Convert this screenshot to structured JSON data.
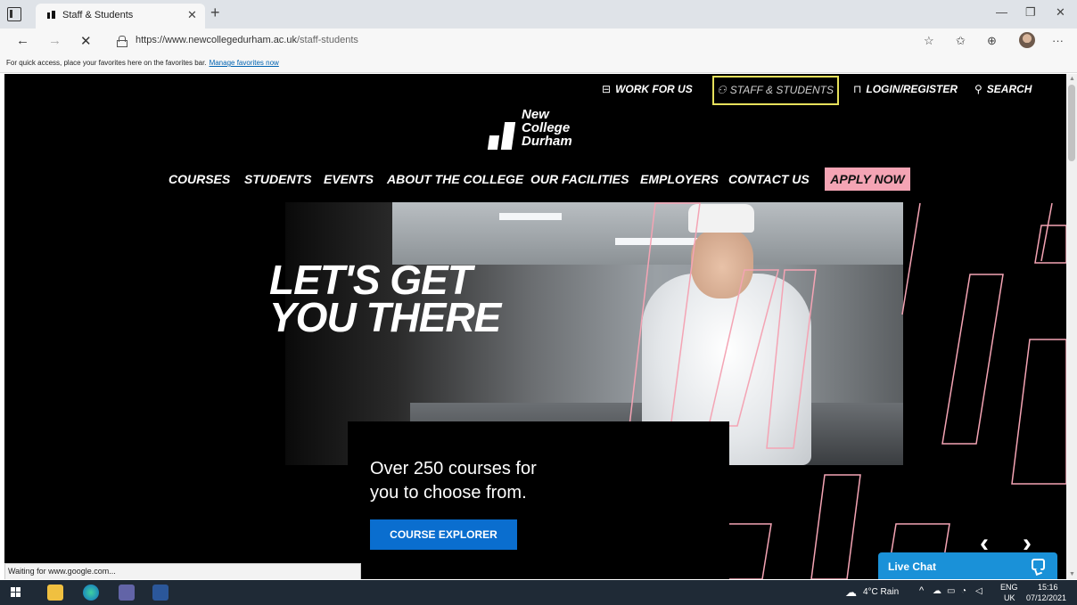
{
  "browser": {
    "tab_title": "Staff & Students",
    "url_host": "https://www.newcollegedurham.ac.uk",
    "url_path": "/staff-students",
    "favorites_prompt": "For quick access, place your favorites here on the favorites bar.",
    "favorites_link": "Manage favorites now",
    "status_text": "Waiting for www.google.com..."
  },
  "site": {
    "utility_nav": [
      {
        "label": "WORK FOR US",
        "icon": "briefcase-icon"
      },
      {
        "label": "STAFF & STUDENTS",
        "icon": "people-icon"
      },
      {
        "label": "LOGIN/REGISTER",
        "icon": "lock-icon"
      },
      {
        "label": "SEARCH",
        "icon": "search-icon"
      }
    ],
    "logo_lines": [
      "New",
      "College",
      "Durham"
    ],
    "main_nav": [
      "COURSES",
      "STUDENTS",
      "EVENTS",
      "ABOUT THE COLLEGE",
      "OUR FACILITIES",
      "EMPLOYERS",
      "CONTACT US"
    ],
    "apply_now": "APPLY NOW",
    "hero_headline": [
      "LET'S GET",
      "YOU THERE"
    ],
    "hero_info": [
      "Over 250 courses for",
      "you to choose from."
    ],
    "course_explorer": "COURSE EXPLORER",
    "slider_prev": "‹",
    "slider_next": "›",
    "live_chat": "Live Chat",
    "accent_pink": "#f4a4b4",
    "accent_blue": "#0a6ecf"
  },
  "taskbar": {
    "weather": "4°C  Rain",
    "language": [
      "ENG",
      "UK"
    ],
    "time": "15:16",
    "date": "07/12/2021"
  }
}
